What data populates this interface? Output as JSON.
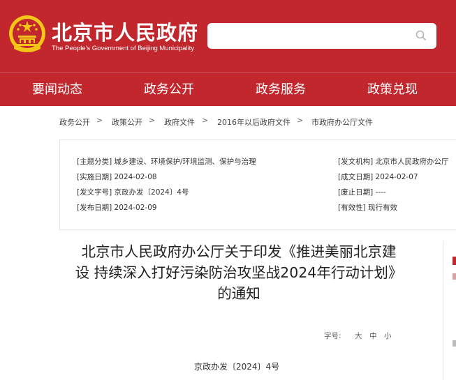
{
  "header": {
    "title": "北京市人民政府",
    "subtitle": "The People's Government of Beijing Municipality",
    "search": {
      "placeholder": ""
    }
  },
  "nav": {
    "items": [
      {
        "label": "要闻动态"
      },
      {
        "label": "政务公开"
      },
      {
        "label": "政务服务"
      },
      {
        "label": "政策兑现"
      }
    ]
  },
  "breadcrumb": {
    "items": [
      "政务公开",
      "政策公开",
      "政府文件",
      "2016年以后政府文件",
      "市政府办公厅文件"
    ],
    "separator": ">"
  },
  "meta": {
    "subject": {
      "key": "[主题分类]",
      "value": "城乡建设、环境保护/环境监测、保护与治理"
    },
    "issuer": {
      "key": "[发文机构]",
      "value": "北京市人民政府办公厅"
    },
    "effective_date": {
      "key": "[实施日期]",
      "value": "2024-02-08"
    },
    "written_date": {
      "key": "[成文日期]",
      "value": "2024-02-07"
    },
    "doc_no": {
      "key": "[发文字号]",
      "value": "京政办发〔2024〕4号"
    },
    "repeal_date": {
      "key": "[废止日期]",
      "value": "----"
    },
    "publish_date": {
      "key": "[发布日期]",
      "value": "2024-02-09"
    },
    "validity": {
      "key": "[有效性]",
      "value": "现行有效"
    }
  },
  "article": {
    "title_lines": [
      "北京市人民政府办公厅关于印发《推进美丽北京建",
      "设 持续深入打好污染防治攻坚战2024年行动计划》",
      "的通知"
    ],
    "font_size": {
      "label": "字号:",
      "large": "大",
      "medium": "中",
      "small": "小"
    },
    "doc_number": "京政办发〔2024〕4号"
  },
  "colors": {
    "brand_red": "#c1272d",
    "emblem_gold": "#f5c518"
  }
}
